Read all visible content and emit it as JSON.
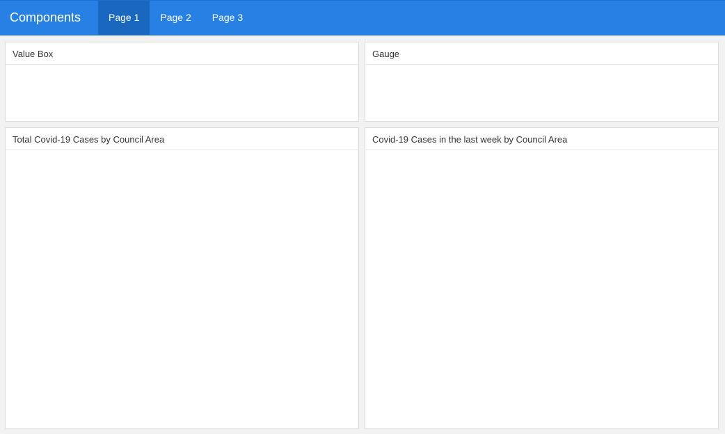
{
  "navbar": {
    "brand": "Components",
    "tabs": [
      {
        "label": "Page 1",
        "active": true
      },
      {
        "label": "Page 2",
        "active": false
      },
      {
        "label": "Page 3",
        "active": false
      }
    ],
    "color": "#2780e3",
    "active_tab_color": "#1967be"
  },
  "panels": {
    "value_box": {
      "title": "Value Box"
    },
    "gauge": {
      "title": "Gauge"
    },
    "total_cases": {
      "title": "Total Covid-19 Cases by Council Area"
    },
    "last_week_cases": {
      "title": "Covid-19 Cases in the last week by Council Area"
    }
  }
}
